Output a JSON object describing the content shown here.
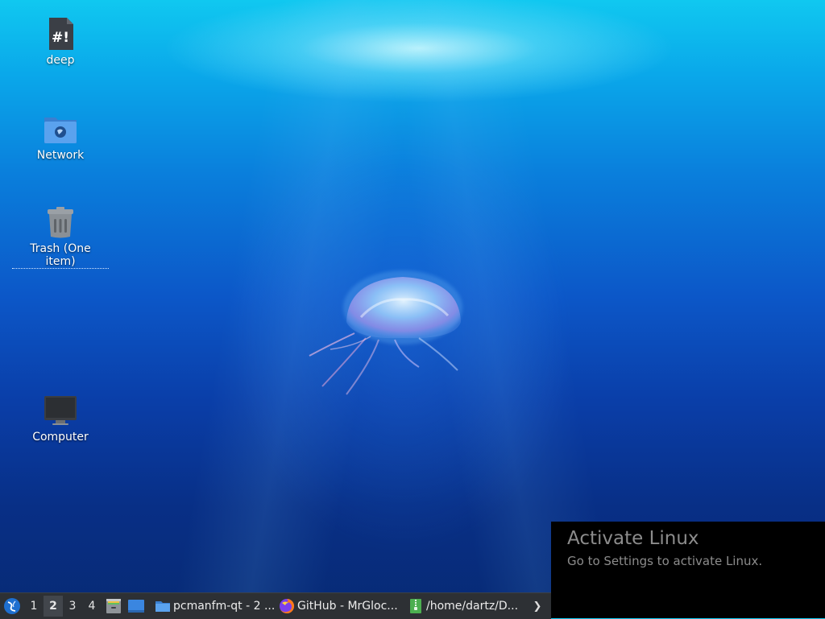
{
  "desktop": {
    "icons": [
      {
        "label": "deep",
        "icon": "script-file-icon"
      },
      {
        "label": "Network",
        "icon": "network-folder-icon"
      },
      {
        "label": "Trash (One item)",
        "icon": "trash-icon"
      },
      {
        "label": "Computer",
        "icon": "computer-icon"
      }
    ]
  },
  "activation": {
    "title": "Activate Linux",
    "subtitle": "Go to Settings to activate Linux."
  },
  "taskbar": {
    "start_icon": "lxqt-start-icon",
    "workspaces": [
      "1",
      "2",
      "3",
      "4"
    ],
    "active_workspace": "2",
    "quicklaunch": [
      {
        "icon": "file-archiver-icon"
      },
      {
        "icon": "show-desktop-icon"
      }
    ],
    "tasks": [
      {
        "label": "pcmanfm-qt - 2 ...",
        "icon": "folder-icon"
      },
      {
        "label": "GitHub - MrGloc...",
        "icon": "firefox-icon"
      },
      {
        "label": "/home/dartz/D...",
        "icon": "archive-icon"
      }
    ],
    "overflow_glyph": "❯"
  },
  "colors": {
    "taskbar_bg": "#2d3034",
    "label_text": "#ffffff",
    "activation_text": "#8c8c8c"
  }
}
